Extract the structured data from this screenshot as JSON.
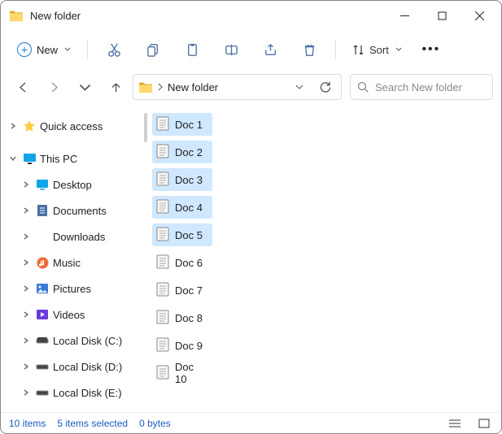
{
  "title": "New folder",
  "toolbar": {
    "new_label": "New",
    "sort_label": "Sort"
  },
  "nav": {
    "crumb": "New folder"
  },
  "search": {
    "placeholder": "Search New folder"
  },
  "sidebar": {
    "quick": "Quick access",
    "this_pc": "This PC",
    "items": [
      {
        "label": "Desktop"
      },
      {
        "label": "Documents"
      },
      {
        "label": "Downloads"
      },
      {
        "label": "Music"
      },
      {
        "label": "Pictures"
      },
      {
        "label": "Videos"
      },
      {
        "label": "Local Disk (C:)"
      },
      {
        "label": "Local Disk (D:)"
      },
      {
        "label": "Local Disk (E:)"
      }
    ]
  },
  "files": [
    {
      "name": "Doc 1",
      "selected": true
    },
    {
      "name": "Doc 2",
      "selected": true
    },
    {
      "name": "Doc 3",
      "selected": true
    },
    {
      "name": "Doc 4",
      "selected": true
    },
    {
      "name": "Doc 5",
      "selected": true
    },
    {
      "name": "Doc 6",
      "selected": false
    },
    {
      "name": "Doc 7",
      "selected": false
    },
    {
      "name": "Doc 8",
      "selected": false
    },
    {
      "name": "Doc 9",
      "selected": false
    },
    {
      "name": "Doc 10",
      "selected": false
    }
  ],
  "status": {
    "count": "10 items",
    "selection": "5 items selected",
    "size": "0 bytes"
  }
}
